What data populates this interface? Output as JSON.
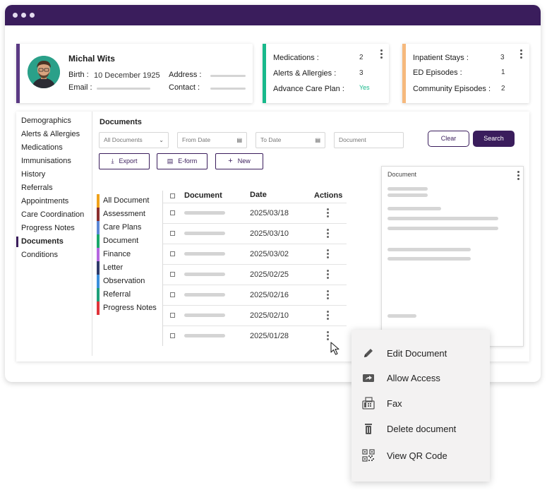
{
  "patient": {
    "name": "Michal Wits",
    "birth_label": "Birth :",
    "birth_value": "10 December 1925",
    "email_label": "Email :",
    "address_label": "Address :",
    "contact_label": "Contact :"
  },
  "summary_card": {
    "medications_label": "Medications :",
    "medications_value": "2",
    "alerts_label": "Alerts & Allergies :",
    "alerts_value": "3",
    "acp_label": "Advance Care Plan :",
    "acp_value": "Yes"
  },
  "episodes_card": {
    "inpatient_label": "Inpatient Stays :",
    "inpatient_value": "3",
    "ed_label": "ED Episodes :",
    "ed_value": "1",
    "community_label": "Community Episodes :",
    "community_value": "2"
  },
  "sidebar": {
    "items": [
      "Demographics",
      "Alerts & Allergies",
      "Medications",
      "Immunisations",
      "History",
      "Referrals",
      "Appointments",
      "Care Coordination",
      "Progress Notes",
      "Documents",
      "Conditions"
    ],
    "active": "Documents"
  },
  "documents": {
    "title": "Documents",
    "filter_select": "All Documents",
    "from_date_placeholder": "From Date",
    "to_date_placeholder": "To Date",
    "document_placeholder": "Document",
    "clear_label": "Clear",
    "search_label": "Search",
    "export_label": "Export",
    "eform_label": "E-form",
    "new_label": "New"
  },
  "doc_types": [
    {
      "label": "All Document",
      "color": "#f0a21b"
    },
    {
      "label": "Assessment",
      "color": "#8b2f2f"
    },
    {
      "label": "Care Plans",
      "color": "#5b87d6"
    },
    {
      "label": "Document",
      "color": "#19a86b"
    },
    {
      "label": "Finance",
      "color": "#b566e0"
    },
    {
      "label": "Letter",
      "color": "#2f3b6b"
    },
    {
      "label": "Observation",
      "color": "#3b8fdc"
    },
    {
      "label": "Referral",
      "color": "#1fa07a"
    },
    {
      "label": "Progress Notes",
      "color": "#e0343a"
    }
  ],
  "table": {
    "col_document": "Document",
    "col_date": "Date",
    "col_actions": "Actions",
    "rows": [
      "2025/03/18",
      "2025/03/10",
      "2025/03/02",
      "2025/02/25",
      "2025/02/16",
      "2025/02/10",
      "2025/01/28"
    ]
  },
  "preview": {
    "title": "Document"
  },
  "context_menu": {
    "items": [
      {
        "label": "Edit Document",
        "icon": "pencil-icon"
      },
      {
        "label": "Allow Access",
        "icon": "share-icon"
      },
      {
        "label": "Fax",
        "icon": "fax-icon"
      },
      {
        "label": "Delete document",
        "icon": "trash-icon"
      },
      {
        "label": "View QR Code",
        "icon": "qr-code-icon"
      }
    ]
  },
  "colors": {
    "brand": "#3a1d5c",
    "patient_card_accent": "#5b3a84",
    "summary_card_accent": "#18b98b",
    "episodes_card_accent": "#f6b97d",
    "yes_color": "#18b98b"
  }
}
